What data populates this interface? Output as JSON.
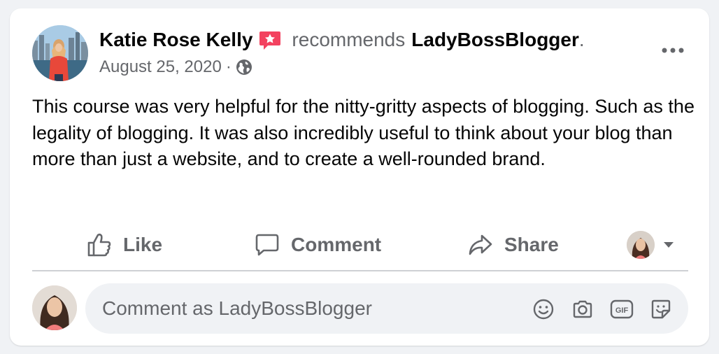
{
  "post": {
    "author": "Katie Rose Kelly",
    "action_text": "recommends",
    "page_name": "LadyBossBlogger",
    "trailing_period": ".",
    "date": "August 25, 2020",
    "separator": "·",
    "privacy_icon": "globe-icon",
    "text": "This course was very helpful for the nitty-gritty aspects of blogging. Such as the legality of blogging. It was also incredibly useful to think about your blog than more than just a website, and to create a well-rounded brand."
  },
  "actions": {
    "like_label": "Like",
    "comment_label": "Comment",
    "share_label": "Share"
  },
  "composer": {
    "placeholder": "Comment as LadyBossBlogger"
  },
  "colors": {
    "recommend_badge": "#f3425f",
    "secondary_text": "#65676b",
    "primary_text": "#050505",
    "card_bg": "#ffffff",
    "page_bg": "#f0f2f5"
  }
}
